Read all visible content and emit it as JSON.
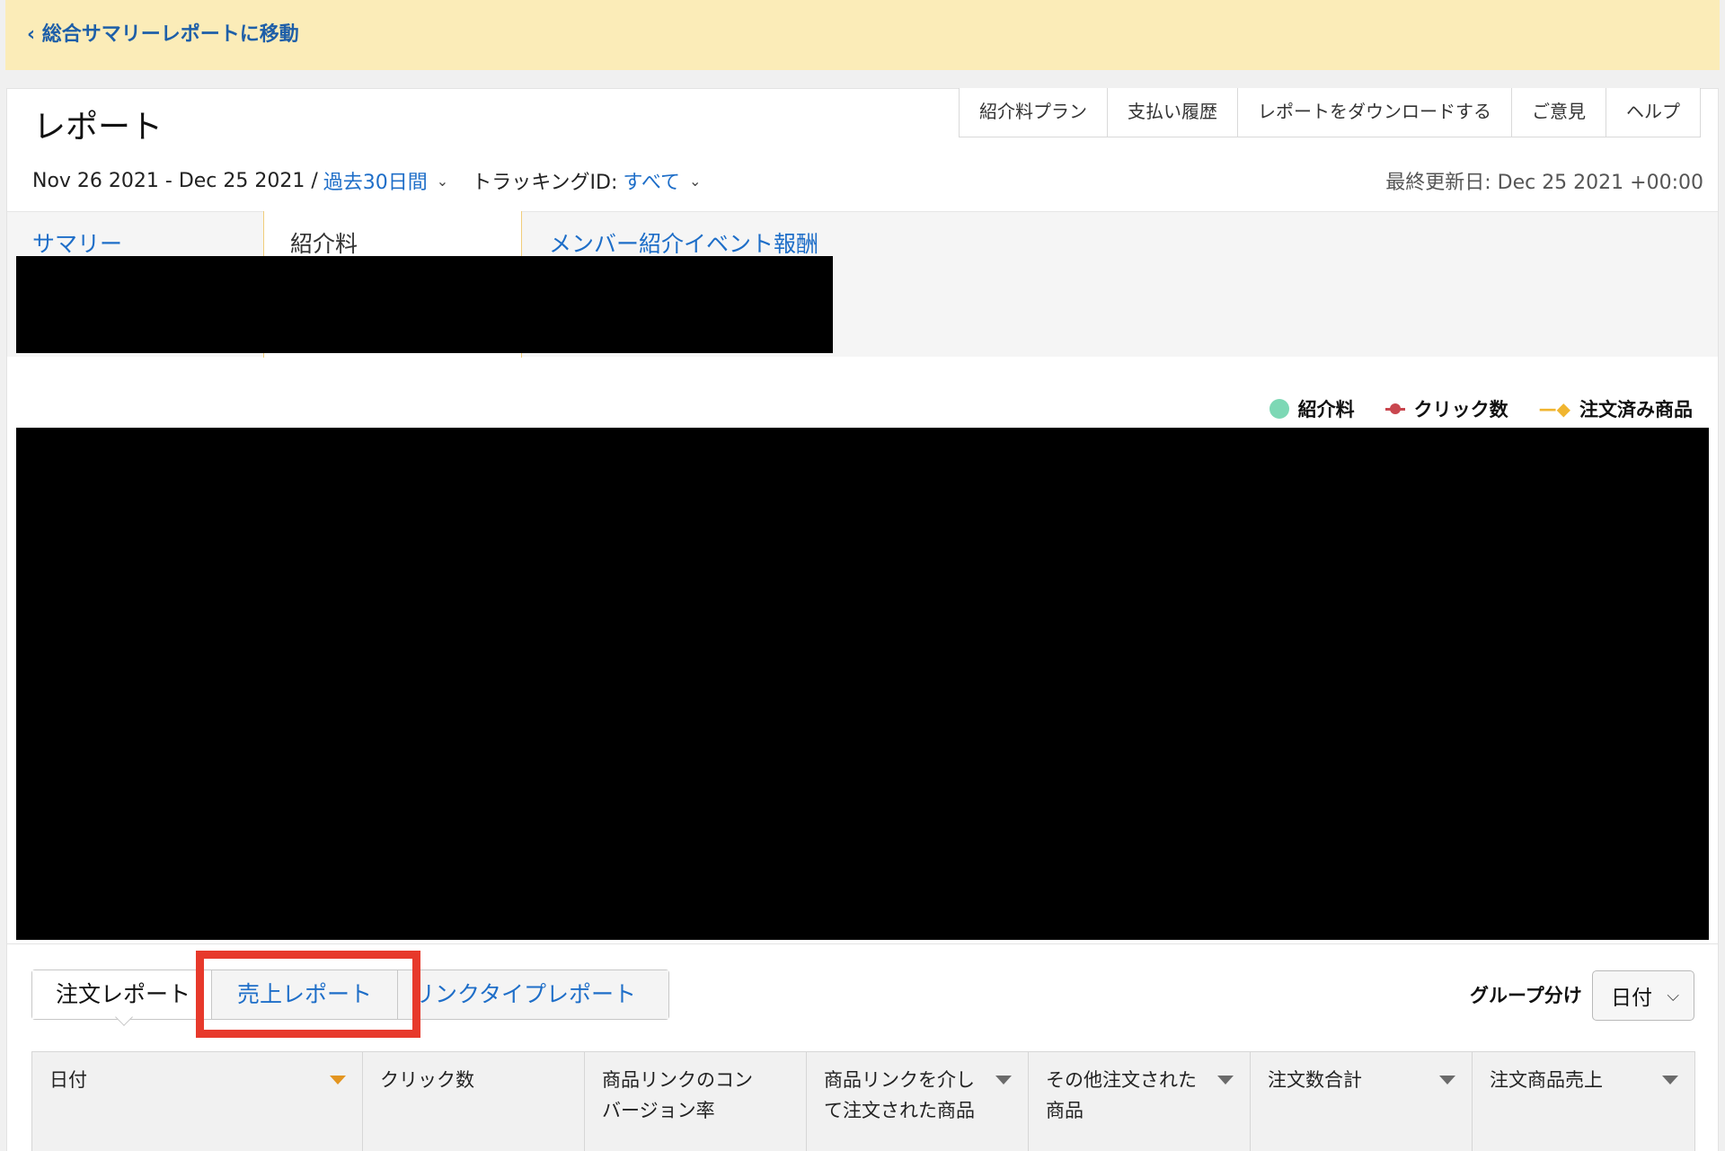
{
  "banner": {
    "back_link": "‹ 総合サマリーレポートに移動"
  },
  "page_title": "レポート",
  "toolbar": {
    "items": [
      "紹介料プラン",
      "支払い履歴",
      "レポートをダウンロードする",
      "ご意見",
      "ヘルプ"
    ]
  },
  "date_row": {
    "range": "Nov 26 2021 - Dec 25 2021 /",
    "period": "過去30日間",
    "tracking_label": "トラッキングID:",
    "tracking_value": "すべて"
  },
  "last_updated": "最終更新日: Dec 25 2021 +00:00",
  "tabs": {
    "summary": "サマリー",
    "commission": "紹介料",
    "referral": "メンバー紹介イベント報酬",
    "active": "紹介料"
  },
  "legend": {
    "commission": "紹介料",
    "clicks": "クリック数",
    "ordered": "注文済み商品"
  },
  "colors": {
    "banner_bg": "#fbecb8",
    "link": "#1e6ec8",
    "highlight": "#e7392b",
    "legend_commission": "#7dd8b5",
    "legend_clicks": "#c9464e",
    "legend_ordered": "#f0b530"
  },
  "report_tabs": {
    "order": "注文レポート",
    "sales": "売上レポート",
    "link_type": "リンクタイプレポート"
  },
  "group_by": {
    "label": "グループ分け",
    "value": "日付"
  },
  "table": {
    "headers": [
      "日付",
      "クリック数",
      "商品リンクのコンバージョン率",
      "商品リンクを介して注文された商品",
      "その他注文された商品",
      "注文数合計",
      "注文商品売上"
    ]
  }
}
